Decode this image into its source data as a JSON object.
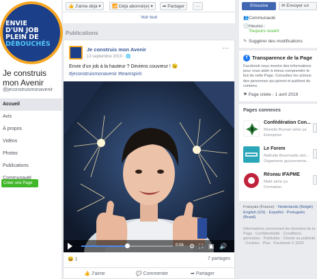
{
  "left": {
    "avatar_lines": [
      "ENVIE",
      "D'UN JOB",
      "PLEIN DE",
      "DÉBOUCHÉS"
    ],
    "page_title": "Je construis mon Avenir",
    "page_handle": "@jeconstruismonavenir",
    "nav": [
      "Accueil",
      "Avis",
      "À propos",
      "Vidéos",
      "Photos",
      "Publications",
      "Communauté"
    ],
    "create_page": "Créer une Page"
  },
  "mid": {
    "actions": {
      "like": "J'aime déjà ▾",
      "follow": "Déjà abonné(e) ▾",
      "share": "Partager",
      "more": "···"
    },
    "see_all": "Voir tout",
    "publications_heading": "Publications",
    "post": {
      "author": "Je construis mon Avenir",
      "date": "13 septembre 2019 · 🌐",
      "text": "Envie d'un job à la hauteur ? Deviens couvreur ! 😉",
      "tags": "#jeconstruismonavenir #teamspirit",
      "video": {
        "time": "0:06",
        "progress": 0.5
      },
      "reaction_count": "1",
      "shares": "7 partages",
      "like_label": "J'aime",
      "comment_label": "Commenter",
      "share_label": "Partager"
    }
  },
  "right": {
    "subscribe": "S'inscrire",
    "message": "Envoyer un",
    "info": {
      "community": "Communauté",
      "hours_label": "Heures :",
      "hours_value": "Toujours ouvert",
      "suggest": "Suggérer des modifications"
    },
    "transparency": {
      "title": "Transparence de la Page",
      "desc": "Facebook vous montre des informations pour vous aider à mieux comprendre le but de cette Page. Consultez les actions des personnes qui gèrent et publient du contenu.",
      "created": "Page créée - 1 avril 2019"
    },
    "related": {
      "title": "Pages connexes",
      "items": [
        {
          "name": "Confédération Con...",
          "sub": "Murielle Brynart aime ça",
          "cat": "Entreprise",
          "color": "#ffffff"
        },
        {
          "name": "Le Forem",
          "sub": "Nathalie Bourrnadis aim...",
          "cat": "Organisme gouverneme...",
          "color": "#2aa6b8"
        },
        {
          "name": "Réseau IFAPME",
          "sub": "Maté aime ça",
          "cat": "Formation",
          "color": "#c0213b"
        }
      ]
    },
    "languages": {
      "line1_a": "Français (France) ·",
      "line1_b": "Nederlands (België)",
      "line2": "English (US) · Español · Português (Brasil)"
    },
    "footer": "Informations concernant les données de la Page · Confidentialité · Conditions générales · Publicités · Choisir sa publicité · Cookies · Plus · Facebook © 2020"
  },
  "colors": {
    "fb_blue": "#4267b2",
    "link": "#385898",
    "green": "#42b72a",
    "bg": "#e9ebee"
  }
}
